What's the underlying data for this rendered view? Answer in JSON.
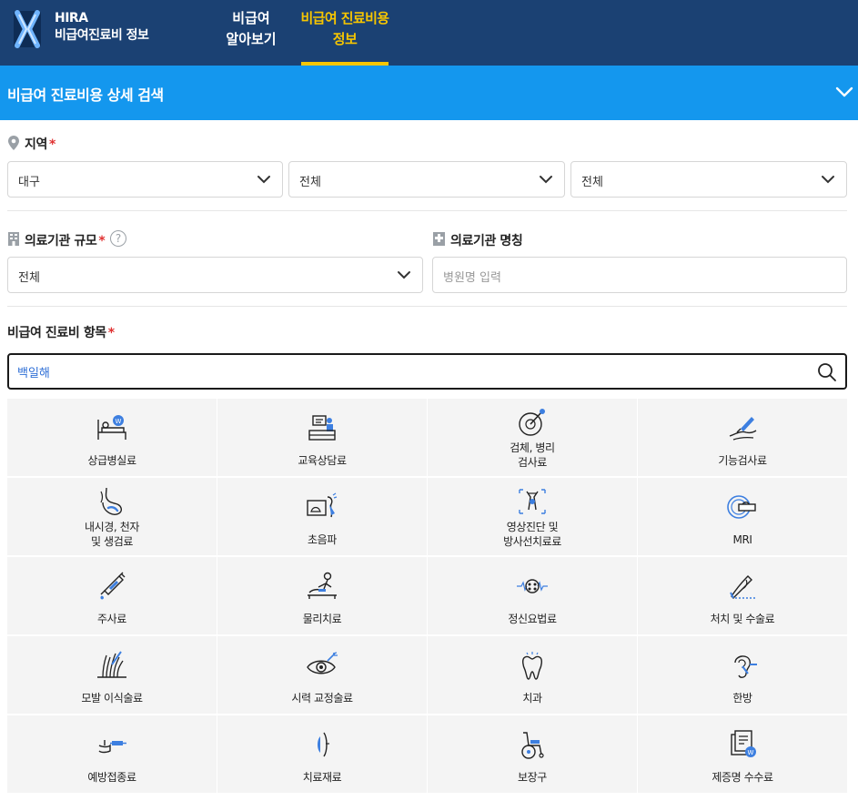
{
  "header": {
    "logo": "hira-logo",
    "brand_line1": "HIRA",
    "brand_line2": "비급여진료비 정보",
    "nav": [
      {
        "line1": "비급여",
        "line2": "알아보기",
        "active": false
      },
      {
        "line1": "비급여 진료비용",
        "line2": "정보",
        "active": true
      }
    ],
    "active_color": "#f7c600",
    "bg_color": "#1b4173"
  },
  "search_panel": {
    "title": "비급여 진료비용 상세 검색",
    "bg_color": "#1497ee",
    "collapse_icon": "chevron-down-icon"
  },
  "region": {
    "label": "지역",
    "required_mark": "*",
    "icon": "location-pin-icon",
    "selects": [
      "대구",
      "전체",
      "전체"
    ]
  },
  "institution_size": {
    "label": "의료기관 규모",
    "required_mark": "*",
    "help": "?",
    "icon": "building-icon",
    "value": "전체"
  },
  "institution_name": {
    "label": "의료기관 명칭",
    "icon": "hospital-icon",
    "placeholder": "병원명 입력"
  },
  "items": {
    "label": "비급여 진료비 항목",
    "required_mark": "*",
    "search_value": "백일해",
    "search_icon": "search-icon"
  },
  "categories": [
    {
      "lines": [
        "상급병실료"
      ],
      "icon": "hospital-bed-icon"
    },
    {
      "lines": [
        "교육상담료"
      ],
      "icon": "consultation-desk-icon"
    },
    {
      "lines": [
        "검체, 병리",
        "검사료"
      ],
      "icon": "specimen-test-icon"
    },
    {
      "lines": [
        "기능검사료"
      ],
      "icon": "function-test-icon"
    },
    {
      "lines": [
        "내시경, 천자",
        "및 생검료"
      ],
      "icon": "endoscopy-icon"
    },
    {
      "lines": [
        "초음파"
      ],
      "icon": "ultrasound-icon"
    },
    {
      "lines": [
        "영상진단 및",
        "방사선치료료"
      ],
      "icon": "xray-icon"
    },
    {
      "lines": [
        "MRI"
      ],
      "icon": "mri-icon"
    },
    {
      "lines": [
        "주사료"
      ],
      "icon": "syringe-icon"
    },
    {
      "lines": [
        "물리치료"
      ],
      "icon": "physical-therapy-icon"
    },
    {
      "lines": [
        "정신요법료"
      ],
      "icon": "brain-icon"
    },
    {
      "lines": [
        "처치 및 수술료"
      ],
      "icon": "surgery-icon"
    },
    {
      "lines": [
        "모발 이식술료"
      ],
      "icon": "hair-transplant-icon"
    },
    {
      "lines": [
        "시력 교정술료"
      ],
      "icon": "eye-correction-icon"
    },
    {
      "lines": [
        "치과"
      ],
      "icon": "tooth-icon"
    },
    {
      "lines": [
        "한방"
      ],
      "icon": "acupuncture-ear-icon"
    },
    {
      "lines": [
        "예방접종료"
      ],
      "icon": "vaccination-icon"
    },
    {
      "lines": [
        "치료재료"
      ],
      "icon": "lens-material-icon"
    },
    {
      "lines": [
        "보장구"
      ],
      "icon": "wheelchair-icon"
    },
    {
      "lines": [
        "제증명 수수료"
      ],
      "icon": "certificate-icon"
    }
  ]
}
